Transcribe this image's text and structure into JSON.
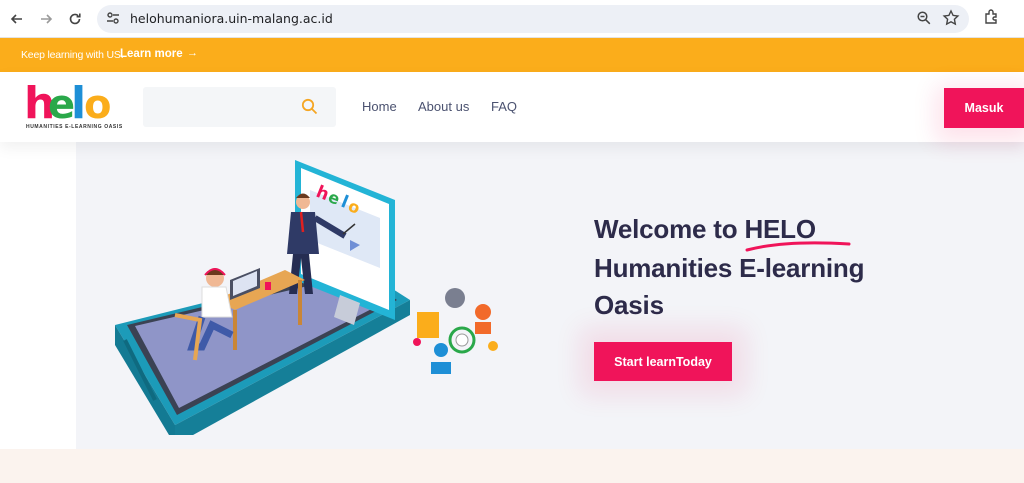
{
  "browser": {
    "url": "helohumaniora.uin-malang.ac.id",
    "icons": [
      "back-icon",
      "forward-icon",
      "reload-icon",
      "site-settings-icon",
      "zoom-icon",
      "star-icon",
      "extensions-icon"
    ]
  },
  "promo": {
    "text": "Keep learning with US.",
    "link": "Learn more",
    "arrow": "→"
  },
  "header": {
    "logo_text": "helo",
    "logo_subtitle": "HUMANITIES E-LEARNING OASIS",
    "search_placeholder": "",
    "menu": [
      "Home",
      "About us",
      "FAQ"
    ],
    "login_label": "Masuk"
  },
  "hero": {
    "title_line1": "Welcome to HELO",
    "title_line2": "Humanities E-learning",
    "title_line3": "Oasis",
    "cta_label": "Start learnToday"
  },
  "colors": {
    "accent": "#f0145a",
    "promo": "#fbad1b",
    "heading": "#2d2b4a"
  }
}
